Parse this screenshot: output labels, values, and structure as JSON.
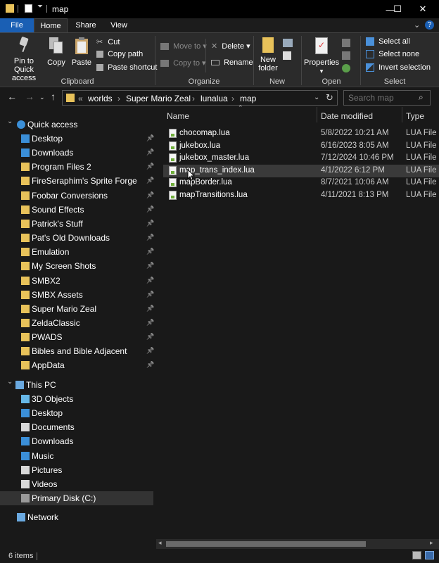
{
  "window": {
    "title": "map",
    "controls": {
      "minimize": "—",
      "maximize": "☐",
      "close": "✕"
    }
  },
  "ribbon_tabs": [
    "File",
    "Home",
    "Share",
    "View"
  ],
  "ribbon": {
    "clipboard": {
      "label": "Clipboard",
      "pin_label_1": "Pin to Quick",
      "pin_label_2": "access",
      "copy": "Copy",
      "paste": "Paste",
      "cut": "Cut",
      "copy_path": "Copy path",
      "paste_shortcut": "Paste shortcut"
    },
    "organize": {
      "label": "Organize",
      "move_to": "Move to",
      "copy_to": "Copy to",
      "delete": "Delete",
      "rename": "Rename"
    },
    "new": {
      "label": "New",
      "new_folder_1": "New",
      "new_folder_2": "folder"
    },
    "open": {
      "label": "Open",
      "properties": "Properties"
    },
    "select": {
      "label": "Select",
      "select_all": "Select all",
      "select_none": "Select none",
      "invert": "Invert selection"
    }
  },
  "address": {
    "overflow": "«",
    "crumbs": [
      "worlds",
      "Super Mario Zeal",
      "lunalua",
      "map"
    ],
    "separator": "›",
    "search_placeholder": "Search map"
  },
  "nav": {
    "quick_access": "Quick access",
    "quick_items": [
      {
        "label": "Desktop",
        "icon": "desktop-icon"
      },
      {
        "label": "Downloads",
        "icon": "downloads-icon"
      },
      {
        "label": "Program Files 2",
        "icon": "folder-icon"
      },
      {
        "label": "FireSeraphim's Sprite Forge",
        "icon": "folder-icon"
      },
      {
        "label": "Foobar Conversions",
        "icon": "folder-icon"
      },
      {
        "label": "Sound Effects",
        "icon": "folder-icon"
      },
      {
        "label": "Patrick's Stuff",
        "icon": "folder-icon"
      },
      {
        "label": "Pat's Old Downloads",
        "icon": "folder-icon"
      },
      {
        "label": "Emulation",
        "icon": "folder-icon"
      },
      {
        "label": "My Screen Shots",
        "icon": "folder-icon"
      },
      {
        "label": "SMBX2",
        "icon": "folder-icon"
      },
      {
        "label": "SMBX Assets",
        "icon": "folder-icon"
      },
      {
        "label": "Super Mario Zeal",
        "icon": "folder-icon"
      },
      {
        "label": "ZeldaClassic",
        "icon": "folder-icon"
      },
      {
        "label": "PWADS",
        "icon": "folder-icon"
      },
      {
        "label": "Bibles and Bible Adjacent",
        "icon": "folder-icon"
      },
      {
        "label": "AppData",
        "icon": "folder-icon"
      }
    ],
    "this_pc": "This PC",
    "pc_items": [
      {
        "label": "3D Objects",
        "icon": "3d-objects-icon"
      },
      {
        "label": "Desktop",
        "icon": "desktop-icon"
      },
      {
        "label": "Documents",
        "icon": "documents-icon"
      },
      {
        "label": "Downloads",
        "icon": "downloads-icon"
      },
      {
        "label": "Music",
        "icon": "music-icon"
      },
      {
        "label": "Pictures",
        "icon": "pictures-icon"
      },
      {
        "label": "Videos",
        "icon": "videos-icon"
      },
      {
        "label": "Primary Disk (C:)",
        "icon": "disk-icon"
      }
    ],
    "network": "Network"
  },
  "columns": {
    "name": "Name",
    "date": "Date modified",
    "type": "Type"
  },
  "files": [
    {
      "name": "chocomap.lua",
      "date": "5/8/2022 10:21 AM",
      "type": "LUA File"
    },
    {
      "name": "jukebox.lua",
      "date": "6/16/2023 8:05 AM",
      "type": "LUA File"
    },
    {
      "name": "jukebox_master.lua",
      "date": "7/12/2024 10:46 PM",
      "type": "LUA File"
    },
    {
      "name": "map_trans_index.lua",
      "date": "4/1/2022 6:12 PM",
      "type": "LUA File"
    },
    {
      "name": "mapBorder.lua",
      "date": "8/7/2021 10:06 AM",
      "type": "LUA File"
    },
    {
      "name": "mapTransitions.lua",
      "date": "4/11/2021 8:13 PM",
      "type": "LUA File"
    }
  ],
  "status": {
    "item_count": "6 items"
  },
  "colors": {
    "accent": "#1a5fb4",
    "folder": "#e8c25a",
    "background": "#191919"
  }
}
